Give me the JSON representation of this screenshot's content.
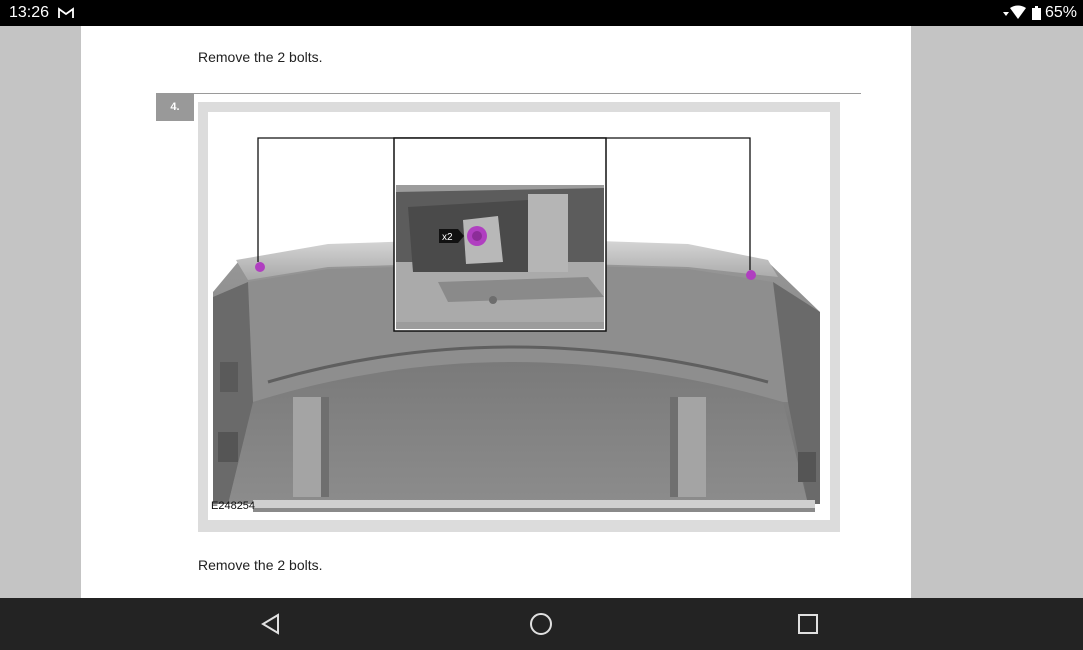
{
  "status_bar": {
    "time": "13:26",
    "notification_icon": "gmail-icon",
    "battery_percent": "65%"
  },
  "document": {
    "instruction_top": "Remove the 2 bolts.",
    "step_number": "4.",
    "figure": {
      "image_id_label": "E248254",
      "callout_label": "x2"
    },
    "instruction_bottom": "Remove the 2 bolts."
  },
  "navigation_bar": {
    "back_icon": "back-triangle-icon",
    "home_icon": "home-circle-icon",
    "recents_icon": "recents-square-icon"
  },
  "colors": {
    "bolt_highlight": "#b03fc0",
    "status_bar_bg": "#000000",
    "nav_bar_bg": "#232323",
    "step_badge_bg": "#999999"
  }
}
